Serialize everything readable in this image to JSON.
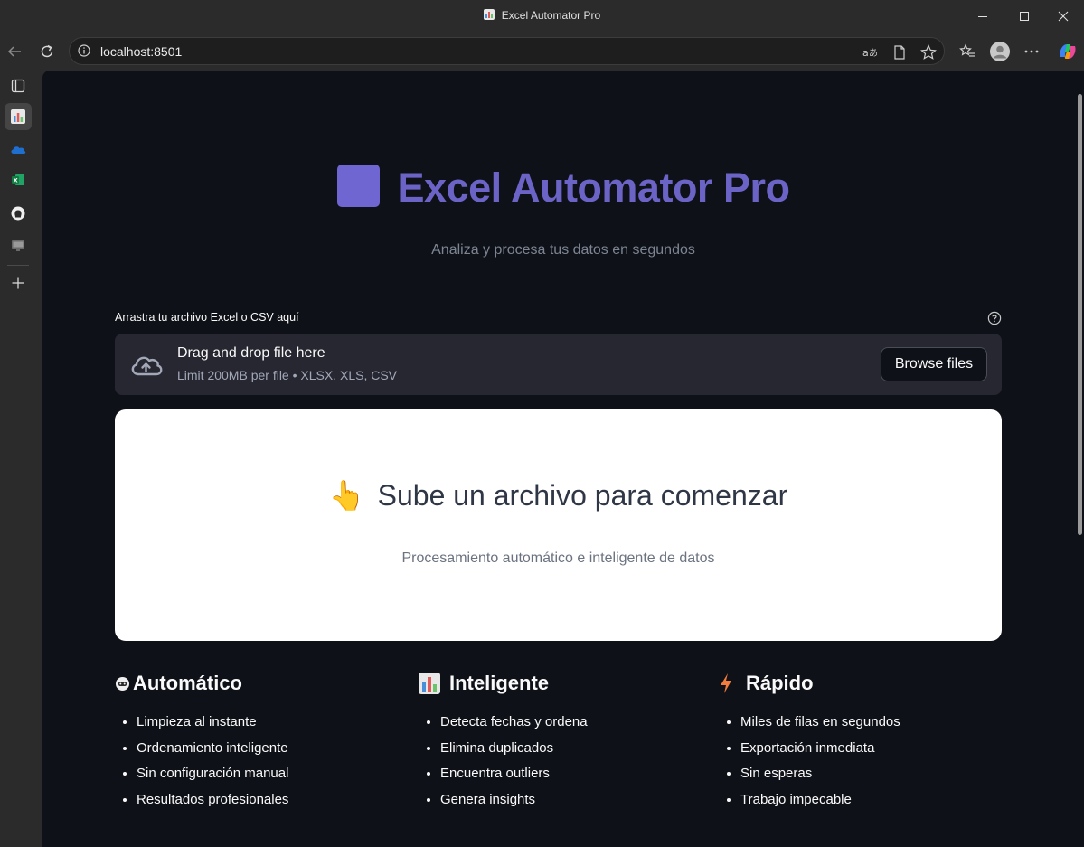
{
  "window": {
    "title": "Excel Automator Pro"
  },
  "browser": {
    "url": "localhost:8501"
  },
  "sidebar": {
    "items": [
      {
        "icon": "sidebar-panel-icon"
      },
      {
        "icon": "app-chart-icon",
        "active": true
      },
      {
        "icon": "onedrive-icon"
      },
      {
        "icon": "excel-icon"
      },
      {
        "icon": "github-icon"
      },
      {
        "icon": "remote-desktop-icon"
      },
      {
        "icon": "add-icon"
      }
    ]
  },
  "app": {
    "title": "Excel Automator Pro",
    "subtitle": "Analiza y procesa tus datos en segundos",
    "upload": {
      "label": "Arrastra tu archivo Excel o CSV aquí",
      "drag_text": "Drag and drop file here",
      "limit_text": "Limit 200MB per file • XLSX, XLS, CSV",
      "browse_label": "Browse files"
    },
    "card": {
      "emoji": "👆",
      "title": "Sube un archivo para comenzar",
      "subtitle": "Procesamiento automático e inteligente de datos"
    },
    "features": [
      {
        "icon": "robot-icon",
        "title": "Automático",
        "items": [
          "Limpieza al instante",
          "Ordenamiento inteligente",
          "Sin configuración manual",
          "Resultados profesionales"
        ]
      },
      {
        "icon": "bar-chart-icon",
        "title": "Inteligente",
        "items": [
          "Detecta fechas y ordena",
          "Elimina duplicados",
          "Encuentra outliers",
          "Genera insights"
        ]
      },
      {
        "icon": "lightning-icon",
        "title": "Rápido",
        "items": [
          "Miles de filas en segundos",
          "Exportación inmediata",
          "Sin esperas",
          "Trabajo impecable"
        ]
      }
    ]
  },
  "colors": {
    "accent": "#6c63c7",
    "background": "#0e1117",
    "dropzone": "#262730"
  }
}
